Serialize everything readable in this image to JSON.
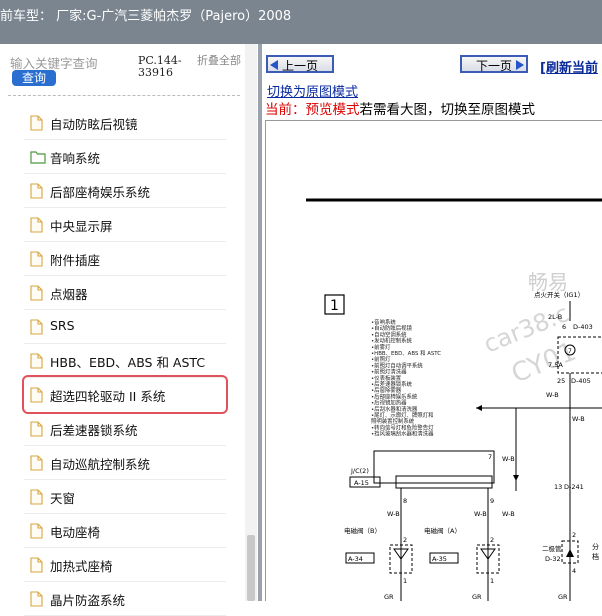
{
  "window": {
    "title": "前车型： 厂家:G-广汽三菱帕杰罗（Pajero）2008"
  },
  "search": {
    "placeholder": "输入关键字查询",
    "button_label": "查询"
  },
  "code": "PC.144-33916",
  "collapse_label": "折叠全部",
  "tree": {
    "items": [
      {
        "label": "自动防眩后视镜",
        "icon": "document-icon",
        "selected": false
      },
      {
        "label": "音响系统",
        "icon": "folder-icon",
        "selected": false
      },
      {
        "label": "后部座椅娱乐系统",
        "icon": "document-icon",
        "selected": false
      },
      {
        "label": "中央显示屏",
        "icon": "document-icon",
        "selected": false
      },
      {
        "label": "附件插座",
        "icon": "document-icon",
        "selected": false
      },
      {
        "label": "点烟器",
        "icon": "document-icon",
        "selected": false
      },
      {
        "label": "SRS",
        "icon": "document-icon",
        "selected": false
      },
      {
        "label": "HBB、EBD、ABS 和 ASTC",
        "icon": "document-icon",
        "selected": false
      },
      {
        "label": "超选四轮驱动 II 系统",
        "icon": "document-icon",
        "selected": true
      },
      {
        "label": "后差速器锁系统",
        "icon": "document-icon",
        "selected": false
      },
      {
        "label": "自动巡航控制系统",
        "icon": "document-icon",
        "selected": false
      },
      {
        "label": "天窗",
        "icon": "document-icon",
        "selected": false
      },
      {
        "label": "电动座椅",
        "icon": "document-icon",
        "selected": false
      },
      {
        "label": "加热式座椅",
        "icon": "document-icon",
        "selected": false
      },
      {
        "label": "晶片防盗系统",
        "icon": "document-icon",
        "selected": false
      }
    ]
  },
  "viewer": {
    "prev_label": "上一页",
    "next_label": "下一页",
    "refresh_label": "[刷新当前",
    "switch_link": "切换为原图模式",
    "mode_prefix": "当前：",
    "mode_name": "预览模式",
    "mode_hint": "若需看大图，切换至原图模式"
  },
  "diagram": {
    "page_number": "1",
    "watermark_1": "畅易",
    "watermark_2": "car38.c",
    "watermark_3": "CY01",
    "ignition_label": "点火开关（IG1）",
    "connector_2l": "2L-B",
    "connector_d403": "D-403",
    "fuse_label": "7.5A",
    "fuse_no": "7",
    "connector_d405": "D-405",
    "connector_d241": "D-241",
    "connector_d32": "D-32",
    "jc2": "J/C(2)",
    "a15": "A-15",
    "solenoid_b": "电磁阀（B）",
    "solenoid_a": "电磁阀（A）",
    "a34": "A-34",
    "a35": "A-35",
    "diode_label": "二极管",
    "wire_wb": "W-B",
    "wire_gr": "GR",
    "pin_6": "6",
    "pin_25": "25",
    "pin_13": "13",
    "pin_7": "7",
    "pin_8": "8",
    "pin_9": "9",
    "pin_2": "2",
    "pin_1": "1",
    "pin_4": "4",
    "right_cut_1": "分",
    "right_cut_2": "档",
    "system_list": [
      "•音响系统",
      "•自动防眩后视镜",
      "•自动空调系统",
      "•发动机控制系统",
      "•前雾灯",
      "•HBB、EBD、ABS 和 ASTC",
      "•前照灯",
      "•前照灯自动调平系统",
      "•前照灯清洗器",
      "•仪表板装置",
      "•后差速器锁系统",
      "•后窗除雾器",
      "•后部座椅娱乐系统",
      "•后视镜加热器",
      "•后刮水器和清洗器",
      "•尾灯、示廓灯、牌照灯和",
      "  照明装置控制系统",
      "•转向信号灯和危险警告灯",
      "•挡风玻璃刮水器和清洗器"
    ]
  }
}
